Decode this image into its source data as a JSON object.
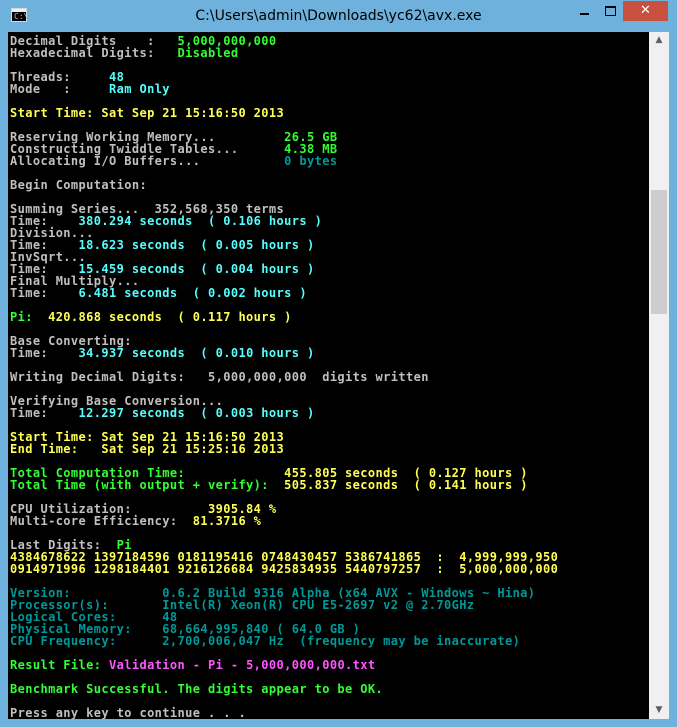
{
  "window": {
    "title": "C:\\Users\\admin\\Downloads\\yc62\\avx.exe",
    "icon_prompt": "C:\\",
    "minimize_glyph": "",
    "maximize_glyph": "",
    "close_glyph": "✕"
  },
  "colors": {
    "titlebar": "#6fb1dd",
    "close": "#c7503f",
    "console_bg": "#000000",
    "grey": "#c0c0c0",
    "green": "#33ff33",
    "yellow": "#ffff55",
    "cyan": "#55ffff",
    "teal": "#009999",
    "magenta": "#ff55ff"
  },
  "console": {
    "lines": [
      {
        "segments": [
          {
            "t": "Decimal Digits    :   ",
            "c": "grey"
          },
          {
            "t": "5,000,000,000",
            "c": "green"
          }
        ]
      },
      {
        "segments": [
          {
            "t": "Hexadecimal Digits:   ",
            "c": "grey"
          },
          {
            "t": "Disabled",
            "c": "green"
          }
        ]
      },
      {
        "segments": []
      },
      {
        "segments": [
          {
            "t": "Threads:     ",
            "c": "grey"
          },
          {
            "t": "48",
            "c": "cyan"
          }
        ]
      },
      {
        "segments": [
          {
            "t": "Mode   :     ",
            "c": "grey"
          },
          {
            "t": "Ram Only",
            "c": "cyan"
          }
        ]
      },
      {
        "segments": []
      },
      {
        "segments": [
          {
            "t": "Start Time: Sat Sep 21 15:16:50 2013",
            "c": "yellow"
          }
        ]
      },
      {
        "segments": []
      },
      {
        "segments": [
          {
            "t": "Reserving Working Memory...         ",
            "c": "grey"
          },
          {
            "t": "26.5 GB",
            "c": "green"
          }
        ]
      },
      {
        "segments": [
          {
            "t": "Constructing Twiddle Tables...      ",
            "c": "grey"
          },
          {
            "t": "4.38 MB",
            "c": "green"
          }
        ]
      },
      {
        "segments": [
          {
            "t": "Allocating I/O Buffers...           ",
            "c": "grey"
          },
          {
            "t": "0 bytes",
            "c": "teal"
          }
        ]
      },
      {
        "segments": []
      },
      {
        "segments": [
          {
            "t": "Begin Computation:",
            "c": "grey"
          }
        ]
      },
      {
        "segments": []
      },
      {
        "segments": [
          {
            "t": "Summing Series...  352,568,350 terms",
            "c": "grey"
          }
        ]
      },
      {
        "segments": [
          {
            "t": "Time:    ",
            "c": "grey"
          },
          {
            "t": "380.294 seconds  ( 0.106 hours )",
            "c": "cyan"
          }
        ]
      },
      {
        "segments": [
          {
            "t": "Division...",
            "c": "grey"
          }
        ]
      },
      {
        "segments": [
          {
            "t": "Time:    ",
            "c": "grey"
          },
          {
            "t": "18.623 seconds  ( 0.005 hours )",
            "c": "cyan"
          }
        ]
      },
      {
        "segments": [
          {
            "t": "InvSqrt...",
            "c": "grey"
          }
        ]
      },
      {
        "segments": [
          {
            "t": "Time:    ",
            "c": "grey"
          },
          {
            "t": "15.459 seconds  ( 0.004 hours )",
            "c": "cyan"
          }
        ]
      },
      {
        "segments": [
          {
            "t": "Final Multiply...",
            "c": "grey"
          }
        ]
      },
      {
        "segments": [
          {
            "t": "Time:    ",
            "c": "grey"
          },
          {
            "t": "6.481 seconds  ( 0.002 hours )",
            "c": "cyan"
          }
        ]
      },
      {
        "segments": []
      },
      {
        "segments": [
          {
            "t": "Pi:  ",
            "c": "green"
          },
          {
            "t": "420.868 seconds  ( 0.117 hours )",
            "c": "yellow"
          }
        ]
      },
      {
        "segments": []
      },
      {
        "segments": [
          {
            "t": "Base Converting:",
            "c": "grey"
          }
        ]
      },
      {
        "segments": [
          {
            "t": "Time:    ",
            "c": "grey"
          },
          {
            "t": "34.937 seconds  ( 0.010 hours )",
            "c": "cyan"
          }
        ]
      },
      {
        "segments": []
      },
      {
        "segments": [
          {
            "t": "Writing Decimal Digits:   5,000,000,000  digits written",
            "c": "grey"
          }
        ]
      },
      {
        "segments": []
      },
      {
        "segments": [
          {
            "t": "Verifying Base Conversion...",
            "c": "grey"
          }
        ]
      },
      {
        "segments": [
          {
            "t": "Time:    ",
            "c": "grey"
          },
          {
            "t": "12.297 seconds  ( 0.003 hours )",
            "c": "cyan"
          }
        ]
      },
      {
        "segments": []
      },
      {
        "segments": [
          {
            "t": "Start Time: Sat Sep 21 15:16:50 2013",
            "c": "yellow"
          }
        ]
      },
      {
        "segments": [
          {
            "t": "End Time:   Sat Sep 21 15:25:16 2013",
            "c": "yellow"
          }
        ]
      },
      {
        "segments": []
      },
      {
        "segments": [
          {
            "t": "Total Computation Time:             ",
            "c": "green"
          },
          {
            "t": "455.805 seconds  ( 0.127 hours )",
            "c": "yellow"
          }
        ]
      },
      {
        "segments": [
          {
            "t": "Total Time (with output + verify):  ",
            "c": "green"
          },
          {
            "t": "505.837 seconds  ( 0.141 hours )",
            "c": "yellow"
          }
        ]
      },
      {
        "segments": []
      },
      {
        "segments": [
          {
            "t": "CPU Utilization:          ",
            "c": "grey"
          },
          {
            "t": "3905.84 %",
            "c": "yellow"
          }
        ]
      },
      {
        "segments": [
          {
            "t": "Multi-core Efficiency:  ",
            "c": "grey"
          },
          {
            "t": "81.3716 %",
            "c": "yellow"
          }
        ]
      },
      {
        "segments": []
      },
      {
        "segments": [
          {
            "t": "Last Digits:  ",
            "c": "grey"
          },
          {
            "t": "Pi",
            "c": "green"
          }
        ]
      },
      {
        "segments": [
          {
            "t": "4384678622 1397184596 0181195416 0748430457 5386741865  :  4,999,999,950",
            "c": "yellow"
          }
        ]
      },
      {
        "segments": [
          {
            "t": "0914971996 1298184401 9216126684 9425834935 5440797257  :  5,000,000,000",
            "c": "yellow"
          }
        ]
      },
      {
        "segments": []
      },
      {
        "segments": [
          {
            "t": "Version:            0.6.2 Build 9316 Alpha (x64 AVX - Windows ~ Hina)",
            "c": "teal"
          }
        ]
      },
      {
        "segments": [
          {
            "t": "Processor(s):       Intel(R) Xeon(R) CPU E5-2697 v2 @ 2.70GHz",
            "c": "teal"
          }
        ]
      },
      {
        "segments": [
          {
            "t": "Logical Cores:      48",
            "c": "teal"
          }
        ]
      },
      {
        "segments": [
          {
            "t": "Physical Memory:    68,664,995,840 ( 64.0 GB )",
            "c": "teal"
          }
        ]
      },
      {
        "segments": [
          {
            "t": "CPU Frequency:      2,700,006,047 Hz  (frequency may be inaccurate)",
            "c": "teal"
          }
        ]
      },
      {
        "segments": []
      },
      {
        "segments": [
          {
            "t": "Result File: ",
            "c": "green"
          },
          {
            "t": "Validation - Pi - 5,000,000,000.txt",
            "c": "magenta"
          }
        ]
      },
      {
        "segments": []
      },
      {
        "segments": [
          {
            "t": "Benchmark Successful. The digits appear to be OK.",
            "c": "green"
          }
        ]
      },
      {
        "segments": []
      },
      {
        "segments": [
          {
            "t": "Press any key to continue . . .",
            "c": "grey"
          }
        ]
      }
    ]
  },
  "scrollbar": {
    "up_glyph": "▲",
    "down_glyph": "▼"
  }
}
